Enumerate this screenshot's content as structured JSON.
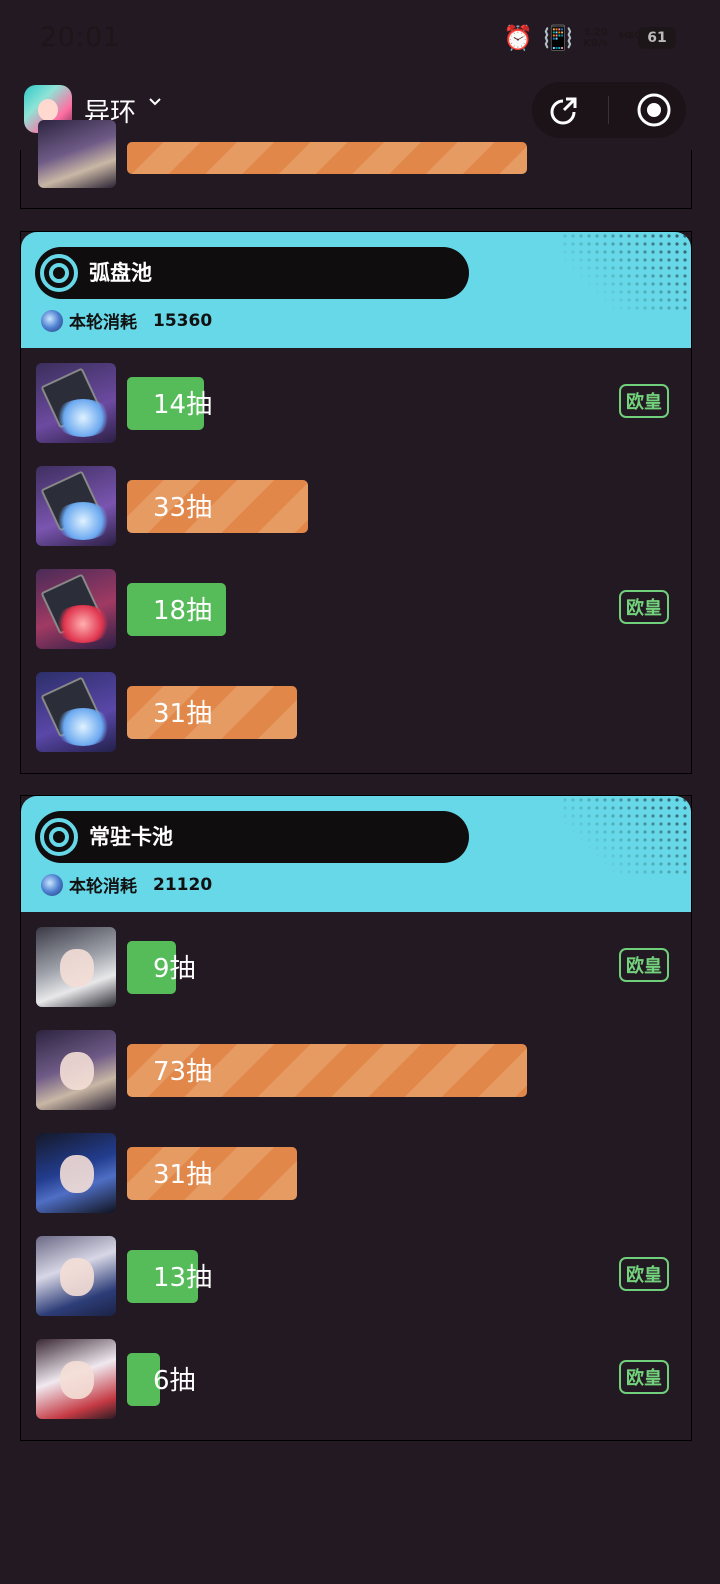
{
  "status_bar": {
    "time": "20:01",
    "speed_line1": "3.20",
    "speed_line2": "KB/s",
    "net1": "4G",
    "net2": "4G",
    "battery": "61",
    "icons": [
      "alarm-icon",
      "vibrate-icon",
      "signal-icon",
      "battery-icon"
    ]
  },
  "header": {
    "app_name": "异环",
    "icons": [
      "app-logo",
      "chevron-down-icon",
      "share-icon",
      "record-icon"
    ]
  },
  "pools": [
    {
      "title": "弧盘池",
      "cost_label": "本轮消耗",
      "cost_value": "15360",
      "items": [
        {
          "pull": "14抽",
          "count": 14,
          "color": "green",
          "badge": "欧皇"
        },
        {
          "pull": "33抽",
          "count": 33,
          "color": "orange",
          "badge": ""
        },
        {
          "pull": "18抽",
          "count": 18,
          "color": "green",
          "badge": "欧皇"
        },
        {
          "pull": "31抽",
          "count": 31,
          "color": "orange",
          "badge": ""
        }
      ]
    },
    {
      "title": "常驻卡池",
      "cost_label": "本轮消耗",
      "cost_value": "21120",
      "items": [
        {
          "pull": "9抽",
          "count": 9,
          "color": "green",
          "badge": "欧皇"
        },
        {
          "pull": "73抽",
          "count": 73,
          "color": "orange",
          "badge": ""
        },
        {
          "pull": "31抽",
          "count": 31,
          "color": "orange",
          "badge": ""
        },
        {
          "pull": "13抽",
          "count": 13,
          "color": "green",
          "badge": "欧皇"
        },
        {
          "pull": "6抽",
          "count": 6,
          "color": "green",
          "badge": "欧皇"
        }
      ]
    }
  ],
  "colors": {
    "background": "#231922",
    "header_cyan": "#66d8e8",
    "bar_orange": "#e2874a",
    "bar_green": "#55bc59",
    "badge_green": "#73d27c"
  }
}
